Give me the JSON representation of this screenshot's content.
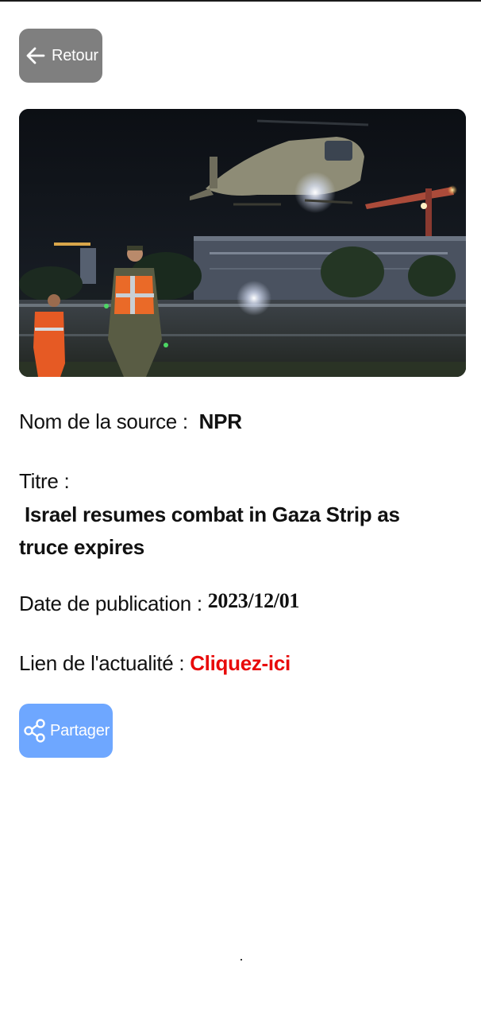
{
  "back_button": {
    "label": "Retour",
    "icon": "arrow-left-icon"
  },
  "article": {
    "image_alt": "",
    "source_label": "Nom de la source :",
    "source_value": "NPR",
    "title_label": "Titre :",
    "title_value": "Israel resumes combat in Gaza Strip as truce expires",
    "date_label": "Date de publication :",
    "date_value": "2023/12/01",
    "link_label": "Lien de l'actualité :",
    "link_value": "Cliquez-ici"
  },
  "share_button": {
    "label": "Partager",
    "icon": "share-icon"
  },
  "colors": {
    "back_button_bg": "#7f7f7f",
    "share_button_bg": "#6ea7ff",
    "link": "#e80a0a",
    "text": "#111111",
    "background": "#ffffff"
  }
}
